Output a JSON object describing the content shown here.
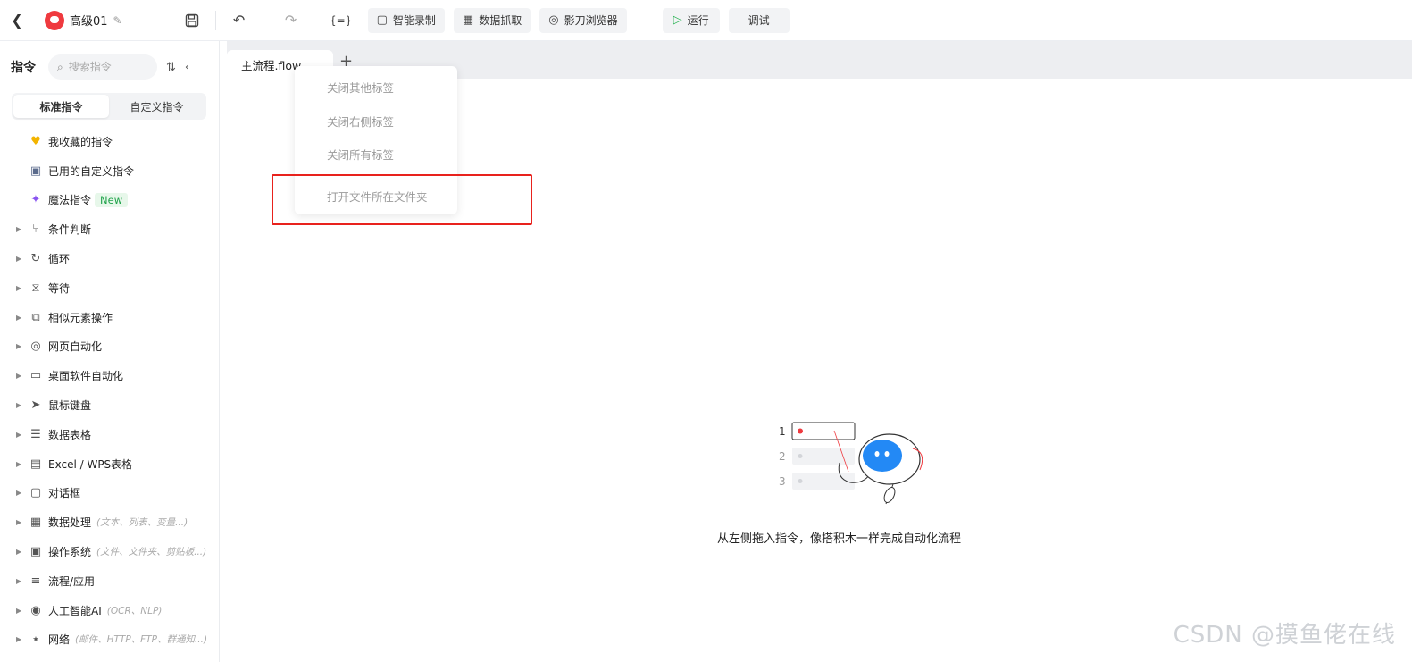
{
  "header": {
    "back_icon": "chevron-left-icon",
    "app_name": "高级01",
    "buttons": {
      "smart_record": "智能录制",
      "data_capture": "数据抓取",
      "shadow_browser": "影刀浏览器",
      "run": "运行",
      "debug": "调试"
    },
    "variable_icon_text": "{=}"
  },
  "sidebar": {
    "title": "指令",
    "search_placeholder": "搜索指令",
    "tabs": {
      "standard": "标准指令",
      "custom": "自定义指令"
    },
    "items": [
      {
        "label": "我收藏的指令",
        "icon": "heart-icon",
        "caret": false
      },
      {
        "label": "已用的自定义指令",
        "icon": "calendar-icon",
        "caret": false
      },
      {
        "label": "魔法指令",
        "icon": "sparkle-icon",
        "caret": false,
        "badge": "New"
      },
      {
        "label": "条件判断",
        "icon": "branch-icon",
        "caret": true
      },
      {
        "label": "循环",
        "icon": "loop-icon",
        "caret": true
      },
      {
        "label": "等待",
        "icon": "hourglass-icon",
        "caret": true
      },
      {
        "label": "相似元素操作",
        "icon": "copy-icon",
        "caret": true
      },
      {
        "label": "网页自动化",
        "icon": "browser-icon",
        "caret": true
      },
      {
        "label": "桌面软件自动化",
        "icon": "monitor-icon",
        "caret": true
      },
      {
        "label": "鼠标键盘",
        "icon": "cursor-icon",
        "caret": true
      },
      {
        "label": "数据表格",
        "icon": "document-icon",
        "caret": true
      },
      {
        "label": "Excel / WPS表格",
        "icon": "excel-icon",
        "caret": true
      },
      {
        "label": "对话框",
        "icon": "dialog-icon",
        "caret": true
      },
      {
        "label": "数据处理",
        "icon": "data-icon",
        "caret": true,
        "hint": "(文本、列表、变量...)"
      },
      {
        "label": "操作系统",
        "icon": "system-icon",
        "caret": true,
        "hint": "(文件、文件夹、剪贴板...)"
      },
      {
        "label": "流程/应用",
        "icon": "layers-icon",
        "caret": true
      },
      {
        "label": "人工智能AI",
        "icon": "ai-icon",
        "caret": true,
        "hint": "(OCR、NLP)"
      },
      {
        "label": "网络",
        "icon": "network-icon",
        "caret": true,
        "hint": "(邮件、HTTP、FTP、群通知...)"
      }
    ]
  },
  "editor": {
    "tab_label": "主流程.flow",
    "context_menu": [
      "关闭其他标签",
      "关闭右侧标签",
      "关闭所有标签",
      "打开文件所在文件夹"
    ],
    "empty_state_numbers": [
      "1",
      "2",
      "3"
    ],
    "empty_state_text": "从左侧拖入指令，像搭积木一样完成自动化流程"
  },
  "watermark": "CSDN @摸鱼佬在线",
  "colors": {
    "highlight": "#e8221d",
    "run_green": "#1fb04b",
    "robot_blue": "#2389f5"
  }
}
